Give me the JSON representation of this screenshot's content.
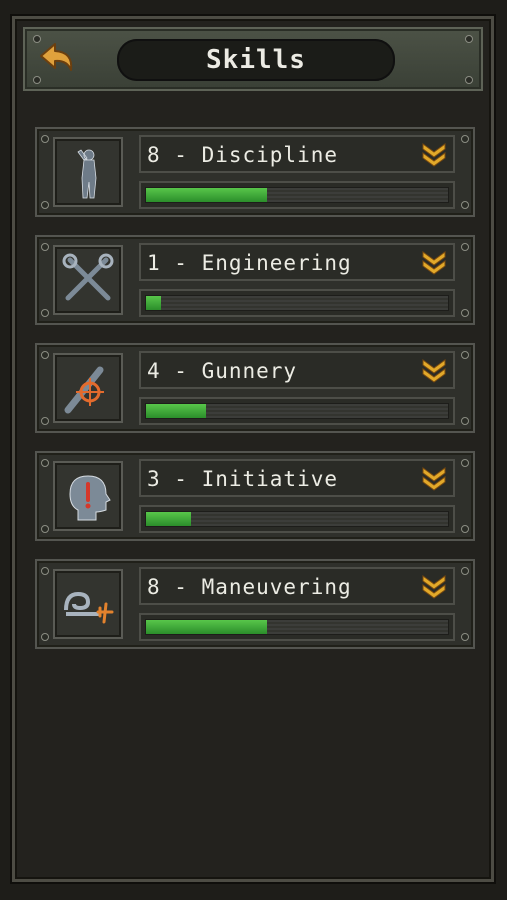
{
  "header": {
    "title": "Skills"
  },
  "skills": [
    {
      "label": "8 - Discipline",
      "icon": "saluting-soldier-icon",
      "progress": 0.4
    },
    {
      "label": "1 - Engineering",
      "icon": "crossed-wrenches-icon",
      "progress": 0.05
    },
    {
      "label": "4 - Gunnery",
      "icon": "crosshair-icon",
      "progress": 0.2
    },
    {
      "label": "3 - Initiative",
      "icon": "head-exclamation-icon",
      "progress": 0.15
    },
    {
      "label": "8 - Maneuvering",
      "icon": "loop-plane-icon",
      "progress": 0.4
    }
  ],
  "colors": {
    "progress_fill": "#3faa34",
    "chevron": "#e2a92a",
    "back_arrow": "#e0a13c"
  }
}
